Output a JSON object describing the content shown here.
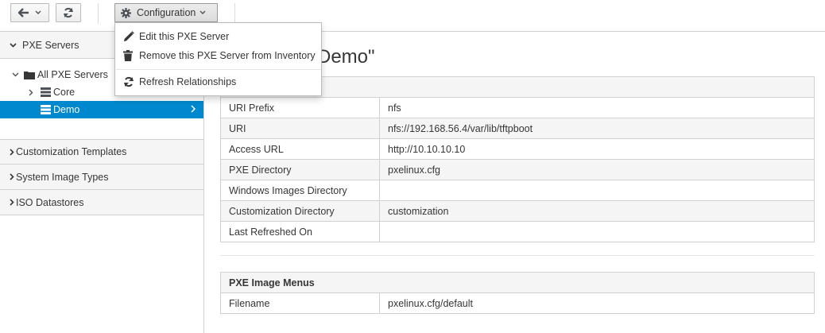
{
  "toolbar": {
    "back_icon": "arrow-left-icon",
    "refresh_icon": "refresh-icon",
    "config_label": "Configuration",
    "config_icon": "gear-icon"
  },
  "dropdown": {
    "items": [
      {
        "label": "Edit this PXE Server",
        "icon": "pencil-icon"
      },
      {
        "label": "Remove this PXE Server from Inventory",
        "icon": "trash-icon"
      },
      {
        "label": "Refresh Relationships",
        "icon": "refresh-icon"
      }
    ]
  },
  "sidebar": {
    "pxe_servers": "PXE Servers",
    "tree": {
      "root": "All PXE Servers",
      "children": [
        "Core",
        "Demo"
      ]
    },
    "sections": [
      "Customization Templates",
      "System Image Types",
      "ISO Datastores"
    ]
  },
  "main": {
    "title_visible": "Demo\"",
    "basic_info": {
      "rows": [
        {
          "key": "URI Prefix",
          "value": "nfs"
        },
        {
          "key": "URI",
          "value": "nfs://192.168.56.4/var/lib/tftpboot"
        },
        {
          "key": "Access URL",
          "value": "http://10.10.10.10"
        },
        {
          "key": "PXE Directory",
          "value": "pxelinux.cfg"
        },
        {
          "key": "Windows Images Directory",
          "value": ""
        },
        {
          "key": "Customization Directory",
          "value": "customization"
        },
        {
          "key": "Last Refreshed On",
          "value": ""
        }
      ]
    },
    "image_menus": {
      "header": "PXE Image Menus",
      "rows": [
        {
          "key": "Filename",
          "value": "pxelinux.cfg/default"
        }
      ]
    }
  },
  "colors": {
    "selected": "#0088ce",
    "header_bg": "#f5f5f5",
    "border": "#d1d1d1"
  }
}
